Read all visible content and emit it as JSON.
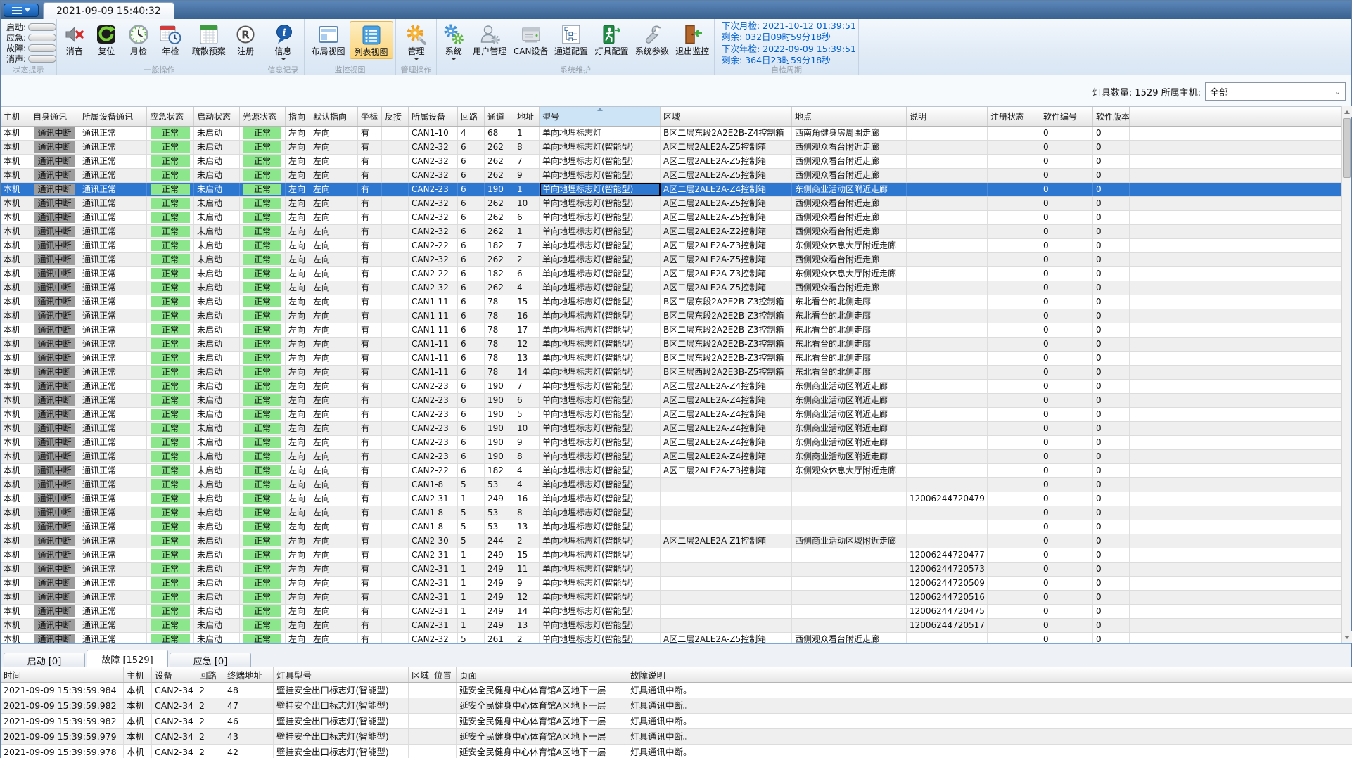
{
  "title_bar": {
    "tab_title": "2021-09-09 15:40:32"
  },
  "ribbon": {
    "status_group": {
      "caption": "状态提示",
      "items": [
        {
          "label": "启动:"
        },
        {
          "label": "应急:"
        },
        {
          "label": "故障:"
        },
        {
          "label": "消声:"
        }
      ]
    },
    "general_group": {
      "caption": "一般操作",
      "items": [
        {
          "label": "消音",
          "icon": "mute-icon"
        },
        {
          "label": "复位",
          "icon": "reset-icon"
        },
        {
          "label": "月检",
          "icon": "monthly-check-icon"
        },
        {
          "label": "年检",
          "icon": "annual-check-icon"
        },
        {
          "label": "疏散预案",
          "icon": "evacuation-plan-icon"
        },
        {
          "label": "注册",
          "icon": "register-icon"
        }
      ]
    },
    "info_group": {
      "caption": "信息记录",
      "items": [
        {
          "label": "信息",
          "icon": "info-icon"
        }
      ]
    },
    "view_group": {
      "caption": "监控视图",
      "items": [
        {
          "label": "布局视图",
          "icon": "layout-view-icon"
        },
        {
          "label": "列表视图",
          "icon": "list-view-icon",
          "selected": true
        }
      ]
    },
    "manage_group": {
      "caption": "管理操作",
      "items": [
        {
          "label": "管理",
          "icon": "manage-icon"
        }
      ]
    },
    "maintenance_group": {
      "caption": "系统维护",
      "items": [
        {
          "label": "系统",
          "icon": "system-icon"
        },
        {
          "label": "用户管理",
          "icon": "user-management-icon"
        },
        {
          "label": "CAN设备",
          "icon": "can-device-icon"
        },
        {
          "label": "通道配置",
          "icon": "channel-config-icon"
        },
        {
          "label": "灯具配置",
          "icon": "lamp-config-icon"
        },
        {
          "label": "系统参数",
          "icon": "system-params-icon"
        },
        {
          "label": "退出监控",
          "icon": "exit-monitor-icon"
        }
      ]
    },
    "selfcheck_group": {
      "caption": "自检周期",
      "lines": [
        "下次月检: 2021-10-12 01:39:51",
        "剩余: 032日09时59分18秒",
        "下次年检: 2022-09-09 15:39:51",
        "剩余: 364日23时59分18秒"
      ]
    }
  },
  "filter_bar": {
    "label": "灯具数量: 1529 所属主机:",
    "value": "全部"
  },
  "main_table": {
    "columns": [
      "主机",
      "自身通讯",
      "所属设备通讯",
      "应急状态",
      "启动状态",
      "光源状态",
      "指向",
      "默认指向",
      "坐标",
      "反接",
      "所属设备",
      "回路",
      "通道",
      "地址",
      "型号",
      "区域",
      "地点",
      "说明",
      "注册状态",
      "软件编号",
      "软件版本"
    ],
    "sorted_column": "型号",
    "common": {
      "host": "本机",
      "self_comm": "通讯中断",
      "device_comm": "通讯正常",
      "emergency": "正常",
      "startup": "未启动",
      "light_source": "正常",
      "direction": "左向",
      "default_direction": "左向",
      "coord": "有",
      "reverse": "",
      "register_state": "",
      "software_no": "0",
      "software_ver": "0"
    },
    "selected_index": 4,
    "rows": [
      {
        "device": "CAN1-10",
        "loop": "4",
        "channel": "68",
        "addr": "1",
        "model": "单向地埋标志灯",
        "area": "B区二层东段2A2E2B-Z4控制箱",
        "location": "西南角健身房周围走廊",
        "note": ""
      },
      {
        "device": "CAN2-32",
        "loop": "6",
        "channel": "262",
        "addr": "8",
        "model": "单向地埋标志灯(智能型)",
        "area": "A区二层2ALE2A-Z5控制箱",
        "location": "西侧观众看台附近走廊",
        "note": ""
      },
      {
        "device": "CAN2-32",
        "loop": "6",
        "channel": "262",
        "addr": "7",
        "model": "单向地埋标志灯(智能型)",
        "area": "A区二层2ALE2A-Z5控制箱",
        "location": "西侧观众看台附近走廊",
        "note": ""
      },
      {
        "device": "CAN2-32",
        "loop": "6",
        "channel": "262",
        "addr": "9",
        "model": "单向地埋标志灯(智能型)",
        "area": "A区二层2ALE2A-Z5控制箱",
        "location": "西侧观众看台附近走廊",
        "note": ""
      },
      {
        "device": "CAN2-23",
        "loop": "6",
        "channel": "190",
        "addr": "1",
        "model": "单向地埋标志灯(智能型)",
        "area": "A区二层2ALE2A-Z4控制箱",
        "location": "东侧商业活动区附近走廊",
        "note": ""
      },
      {
        "device": "CAN2-32",
        "loop": "6",
        "channel": "262",
        "addr": "10",
        "model": "单向地埋标志灯(智能型)",
        "area": "A区二层2ALE2A-Z5控制箱",
        "location": "西侧观众看台附近走廊",
        "note": ""
      },
      {
        "device": "CAN2-32",
        "loop": "6",
        "channel": "262",
        "addr": "6",
        "model": "单向地埋标志灯(智能型)",
        "area": "A区二层2ALE2A-Z5控制箱",
        "location": "西侧观众看台附近走廊",
        "note": ""
      },
      {
        "device": "CAN2-32",
        "loop": "6",
        "channel": "262",
        "addr": "1",
        "model": "单向地埋标志灯(智能型)",
        "area": "A区二层2ALE2A-Z2控制箱",
        "location": "西侧观众看台附近走廊",
        "note": ""
      },
      {
        "device": "CAN2-22",
        "loop": "6",
        "channel": "182",
        "addr": "7",
        "model": "单向地埋标志灯(智能型)",
        "area": "A区二层2ALE2A-Z3控制箱",
        "location": "东侧观众休息大厅附近走廊",
        "note": ""
      },
      {
        "device": "CAN2-32",
        "loop": "6",
        "channel": "262",
        "addr": "2",
        "model": "单向地埋标志灯(智能型)",
        "area": "A区二层2ALE2A-Z5控制箱",
        "location": "西侧观众看台附近走廊",
        "note": ""
      },
      {
        "device": "CAN2-22",
        "loop": "6",
        "channel": "182",
        "addr": "6",
        "model": "单向地埋标志灯(智能型)",
        "area": "A区二层2ALE2A-Z3控制箱",
        "location": "东侧观众休息大厅附近走廊",
        "note": ""
      },
      {
        "device": "CAN2-32",
        "loop": "6",
        "channel": "262",
        "addr": "4",
        "model": "单向地埋标志灯(智能型)",
        "area": "A区二层2ALE2A-Z5控制箱",
        "location": "西侧观众看台附近走廊",
        "note": ""
      },
      {
        "device": "CAN1-11",
        "loop": "6",
        "channel": "78",
        "addr": "15",
        "model": "单向地埋标志灯(智能型)",
        "area": "B区二层东段2A2E2B-Z3控制箱",
        "location": "东北看台的北侧走廊",
        "note": ""
      },
      {
        "device": "CAN1-11",
        "loop": "6",
        "channel": "78",
        "addr": "16",
        "model": "单向地埋标志灯(智能型)",
        "area": "B区二层东段2A2E2B-Z3控制箱",
        "location": "东北看台的北侧走廊",
        "note": ""
      },
      {
        "device": "CAN1-11",
        "loop": "6",
        "channel": "78",
        "addr": "17",
        "model": "单向地埋标志灯(智能型)",
        "area": "B区二层东段2A2E2B-Z3控制箱",
        "location": "东北看台的北侧走廊",
        "note": ""
      },
      {
        "device": "CAN1-11",
        "loop": "6",
        "channel": "78",
        "addr": "12",
        "model": "单向地埋标志灯(智能型)",
        "area": "B区二层东段2A2E2B-Z3控制箱",
        "location": "东北看台的北侧走廊",
        "note": ""
      },
      {
        "device": "CAN1-11",
        "loop": "6",
        "channel": "78",
        "addr": "13",
        "model": "单向地埋标志灯(智能型)",
        "area": "B区二层东段2A2E2B-Z3控制箱",
        "location": "东北看台的北侧走廊",
        "note": ""
      },
      {
        "device": "CAN1-11",
        "loop": "6",
        "channel": "78",
        "addr": "14",
        "model": "单向地埋标志灯(智能型)",
        "area": "B区三层西段2A2E3B-Z5控制箱",
        "location": "东北看台的北侧走廊",
        "note": ""
      },
      {
        "device": "CAN2-23",
        "loop": "6",
        "channel": "190",
        "addr": "7",
        "model": "单向地埋标志灯(智能型)",
        "area": "A区二层2ALE2A-Z4控制箱",
        "location": "东侧商业活动区附近走廊",
        "note": ""
      },
      {
        "device": "CAN2-23",
        "loop": "6",
        "channel": "190",
        "addr": "6",
        "model": "单向地埋标志灯(智能型)",
        "area": "A区二层2ALE2A-Z4控制箱",
        "location": "东侧商业活动区附近走廊",
        "note": ""
      },
      {
        "device": "CAN2-23",
        "loop": "6",
        "channel": "190",
        "addr": "5",
        "model": "单向地埋标志灯(智能型)",
        "area": "A区二层2ALE2A-Z4控制箱",
        "location": "东侧商业活动区附近走廊",
        "note": ""
      },
      {
        "device": "CAN2-23",
        "loop": "6",
        "channel": "190",
        "addr": "10",
        "model": "单向地埋标志灯(智能型)",
        "area": "A区二层2ALE2A-Z4控制箱",
        "location": "东侧商业活动区附近走廊",
        "note": ""
      },
      {
        "device": "CAN2-23",
        "loop": "6",
        "channel": "190",
        "addr": "9",
        "model": "单向地埋标志灯(智能型)",
        "area": "A区二层2ALE2A-Z4控制箱",
        "location": "东侧商业活动区附近走廊",
        "note": ""
      },
      {
        "device": "CAN2-23",
        "loop": "6",
        "channel": "190",
        "addr": "8",
        "model": "单向地埋标志灯(智能型)",
        "area": "A区二层2ALE2A-Z4控制箱",
        "location": "东侧商业活动区附近走廊",
        "note": ""
      },
      {
        "device": "CAN2-22",
        "loop": "6",
        "channel": "182",
        "addr": "4",
        "model": "单向地埋标志灯(智能型)",
        "area": "A区二层2ALE2A-Z3控制箱",
        "location": "东侧观众休息大厅附近走廊",
        "note": ""
      },
      {
        "device": "CAN1-8",
        "loop": "5",
        "channel": "53",
        "addr": "4",
        "model": "单向地埋标志灯(智能型)",
        "area": "",
        "location": "",
        "note": ""
      },
      {
        "device": "CAN2-31",
        "loop": "1",
        "channel": "249",
        "addr": "16",
        "model": "单向地埋标志灯(智能型)",
        "area": "",
        "location": "",
        "note": "12006244720479"
      },
      {
        "device": "CAN1-8",
        "loop": "5",
        "channel": "53",
        "addr": "8",
        "model": "单向地埋标志灯(智能型)",
        "area": "",
        "location": "",
        "note": ""
      },
      {
        "device": "CAN1-8",
        "loop": "5",
        "channel": "53",
        "addr": "13",
        "model": "单向地埋标志灯(智能型)",
        "area": "",
        "location": "",
        "note": ""
      },
      {
        "device": "CAN2-30",
        "loop": "5",
        "channel": "244",
        "addr": "2",
        "model": "单向地埋标志灯(智能型)",
        "area": "A区二层2ALE2A-Z1控制箱",
        "location": "西侧商业活动区域附近走廊",
        "note": ""
      },
      {
        "device": "CAN2-31",
        "loop": "1",
        "channel": "249",
        "addr": "15",
        "model": "单向地埋标志灯(智能型)",
        "area": "",
        "location": "",
        "note": "12006244720477"
      },
      {
        "device": "CAN2-31",
        "loop": "1",
        "channel": "249",
        "addr": "11",
        "model": "单向地埋标志灯(智能型)",
        "area": "",
        "location": "",
        "note": "12006244720573"
      },
      {
        "device": "CAN2-31",
        "loop": "1",
        "channel": "249",
        "addr": "9",
        "model": "单向地埋标志灯(智能型)",
        "area": "",
        "location": "",
        "note": "12006244720509"
      },
      {
        "device": "CAN2-31",
        "loop": "1",
        "channel": "249",
        "addr": "12",
        "model": "单向地埋标志灯(智能型)",
        "area": "",
        "location": "",
        "note": "12006244720516"
      },
      {
        "device": "CAN2-31",
        "loop": "1",
        "channel": "249",
        "addr": "14",
        "model": "单向地埋标志灯(智能型)",
        "area": "",
        "location": "",
        "note": "12006244720475"
      },
      {
        "device": "CAN2-31",
        "loop": "1",
        "channel": "249",
        "addr": "13",
        "model": "单向地埋标志灯(智能型)",
        "area": "",
        "location": "",
        "note": "12006244720517"
      },
      {
        "device": "CAN2-32",
        "loop": "5",
        "channel": "261",
        "addr": "2",
        "model": "单向地埋标志灯(智能型)",
        "area": "A区二层2ALE2A-Z5控制箱",
        "location": "西侧观众看台附近走廊",
        "note": ""
      }
    ]
  },
  "bottom_panel": {
    "tabs": [
      {
        "label": "启动 [0]",
        "active": false
      },
      {
        "label": "故障 [1529]",
        "active": true
      },
      {
        "label": "应急 [0]",
        "active": false
      }
    ],
    "fault_table": {
      "columns": [
        "时间",
        "主机",
        "设备",
        "回路",
        "终端地址",
        "灯具型号",
        "区域",
        "位置",
        "页面",
        "故障说明"
      ],
      "rows": [
        {
          "time": "2021-09-09 15:39:59.984",
          "host": "本机",
          "device": "CAN2-34",
          "loop": "2",
          "addr": "48",
          "model": "壁挂安全出口标志灯(智能型)",
          "area": "",
          "pos": "",
          "page": "延安全民健身中心体育馆A区地下一层",
          "desc": "灯具通讯中断。"
        },
        {
          "time": "2021-09-09 15:39:59.982",
          "host": "本机",
          "device": "CAN2-34",
          "loop": "2",
          "addr": "47",
          "model": "壁挂安全出口标志灯(智能型)",
          "area": "",
          "pos": "",
          "page": "延安全民健身中心体育馆A区地下一层",
          "desc": "灯具通讯中断。"
        },
        {
          "time": "2021-09-09 15:39:59.982",
          "host": "本机",
          "device": "CAN2-34",
          "loop": "2",
          "addr": "46",
          "model": "壁挂安全出口标志灯(智能型)",
          "area": "",
          "pos": "",
          "page": "延安全民健身中心体育馆A区地下一层",
          "desc": "灯具通讯中断。"
        },
        {
          "time": "2021-09-09 15:39:59.979",
          "host": "本机",
          "device": "CAN2-34",
          "loop": "2",
          "addr": "43",
          "model": "壁挂安全出口标志灯(智能型)",
          "area": "",
          "pos": "",
          "page": "延安全民健身中心体育馆A区地下一层",
          "desc": "灯具通讯中断。"
        },
        {
          "time": "2021-09-09 15:39:59.978",
          "host": "本机",
          "device": "CAN2-34",
          "loop": "2",
          "addr": "42",
          "model": "壁挂安全出口标志灯(智能型)",
          "area": "",
          "pos": "",
          "page": "延安全民健身中心体育馆A区地下一层",
          "desc": "灯具通讯中断。"
        }
      ]
    }
  }
}
